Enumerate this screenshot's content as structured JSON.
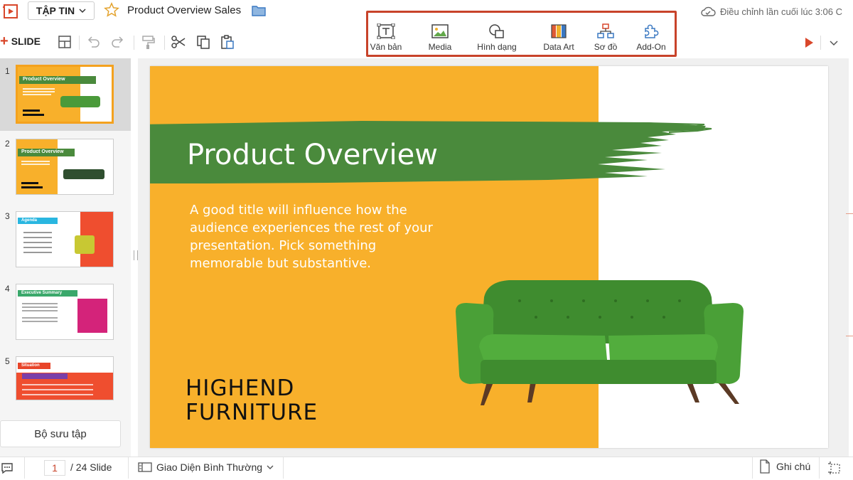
{
  "header": {
    "file_menu_label": "TẬP TIN",
    "doc_title": "Product Overview Sales",
    "last_edited": "Điều chỉnh lần cuối lúc 3:06 C"
  },
  "toolbar": {
    "add_slide_label": "SLIDE",
    "insert_items": [
      {
        "label": "Văn bản",
        "icon": "text-box-icon"
      },
      {
        "label": "Media",
        "icon": "image-icon"
      },
      {
        "label": "Hình dạng",
        "icon": "shapes-icon"
      },
      {
        "label": "Data Art",
        "icon": "data-art-icon"
      },
      {
        "label": "Sơ đồ",
        "icon": "diagram-icon"
      },
      {
        "label": "Add-On",
        "icon": "puzzle-icon"
      }
    ],
    "highlight_color": "#c8432a"
  },
  "slides_panel": {
    "thumbnails": [
      {
        "number": "1",
        "title": "Product Overview",
        "selected": true
      },
      {
        "number": "2",
        "title": "Product Overview",
        "selected": false
      },
      {
        "number": "3",
        "title": "Agenda",
        "selected": false
      },
      {
        "number": "4",
        "title": "Executive Summary",
        "selected": false
      },
      {
        "number": "5",
        "title": "Situation",
        "selected": false
      }
    ],
    "collection_label": "Bộ sưu tập"
  },
  "slide": {
    "title": "Product Overview",
    "body": "A good title will influence how the audience experiences the rest of your presentation. Pick something memorable but substantive.",
    "brand_line1": "HIGHEND",
    "brand_line2": "FURNITURE",
    "bg_color": "#f8b02b",
    "brush_color": "#4a8a3c",
    "sofa_color": "#4a9a3a"
  },
  "statusbar": {
    "current_page": "1",
    "total_pages": "/ 24 Slide",
    "view_mode": "Giao Diện Bình Thường",
    "notes_label": "Ghi chú"
  }
}
